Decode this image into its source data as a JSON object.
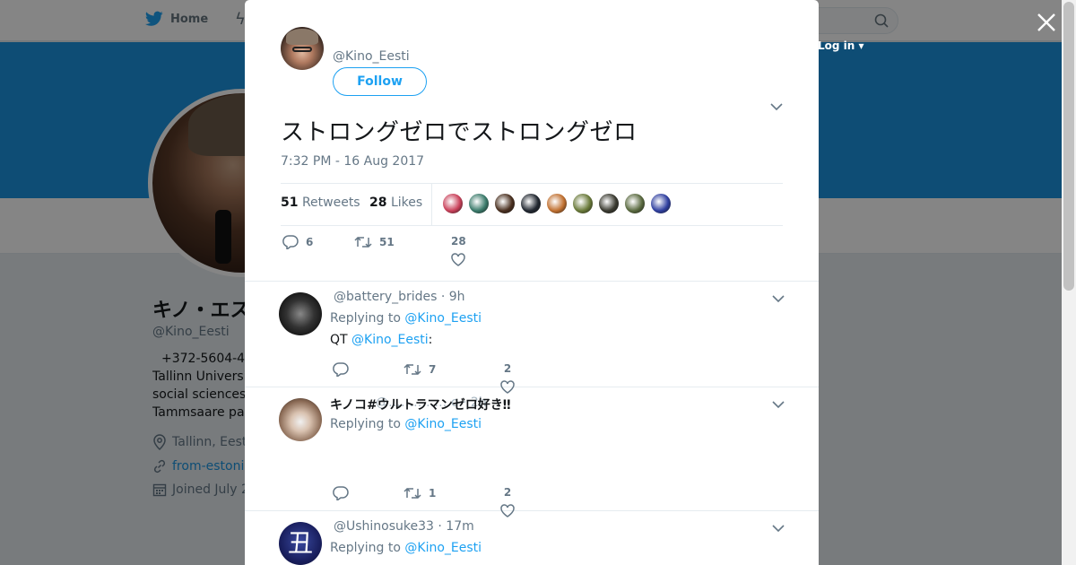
{
  "nav": {
    "home_label": "Home",
    "login_label": "Log in ▾"
  },
  "profile": {
    "name": "キノ・エスティ",
    "handle": "@Kino_Eesti",
    "bio_lines": [
      "+372-5604-4",
      "Tallinn Universi",
      "social sciences",
      "Tammsaare pa"
    ],
    "location": "Tallinn, Eest",
    "website": "from-estoni",
    "joined": "Joined July 2"
  },
  "tweet": {
    "handle": "@Kino_Eesti",
    "follow_label": "Follow",
    "text": "ストロングゼロでストロングゼロ",
    "timestamp": "7:32 PM - 16 Aug 2017",
    "retweets_count": "51",
    "retweets_label": "Retweets",
    "likes_count": "28",
    "likes_label": "Likes",
    "replies_count": "6",
    "rt_count": "51",
    "fav_count": "28",
    "liker_colors": [
      "#c9415a",
      "#3a7a6a",
      "#4a3020",
      "#222831",
      "#c07030",
      "#6a7a3a",
      "#3a3a30",
      "#5a6a40",
      "#3040a0"
    ]
  },
  "replies": [
    {
      "head": "@battery_brides · 9h",
      "replying_label": "Replying to",
      "replying_to": "@Kino_Eesti",
      "body_prefix": "QT",
      "body_mention": "@Kino_Eesti",
      "body_suffix": ":",
      "retweets": "7",
      "likes": "2"
    },
    {
      "name": "キノコ#ウルトラマンゼロ好き‼",
      "head": "@……………o · 2h",
      "replying_label": "Replying to",
      "replying_to": "@Kino_Eesti",
      "retweets": "1",
      "likes": "2"
    },
    {
      "head": "@Ushinosuke33 · 17m",
      "replying_label": "Replying to",
      "replying_to": "@Kino_Eesti",
      "avatar_glyph": "丑"
    }
  ]
}
